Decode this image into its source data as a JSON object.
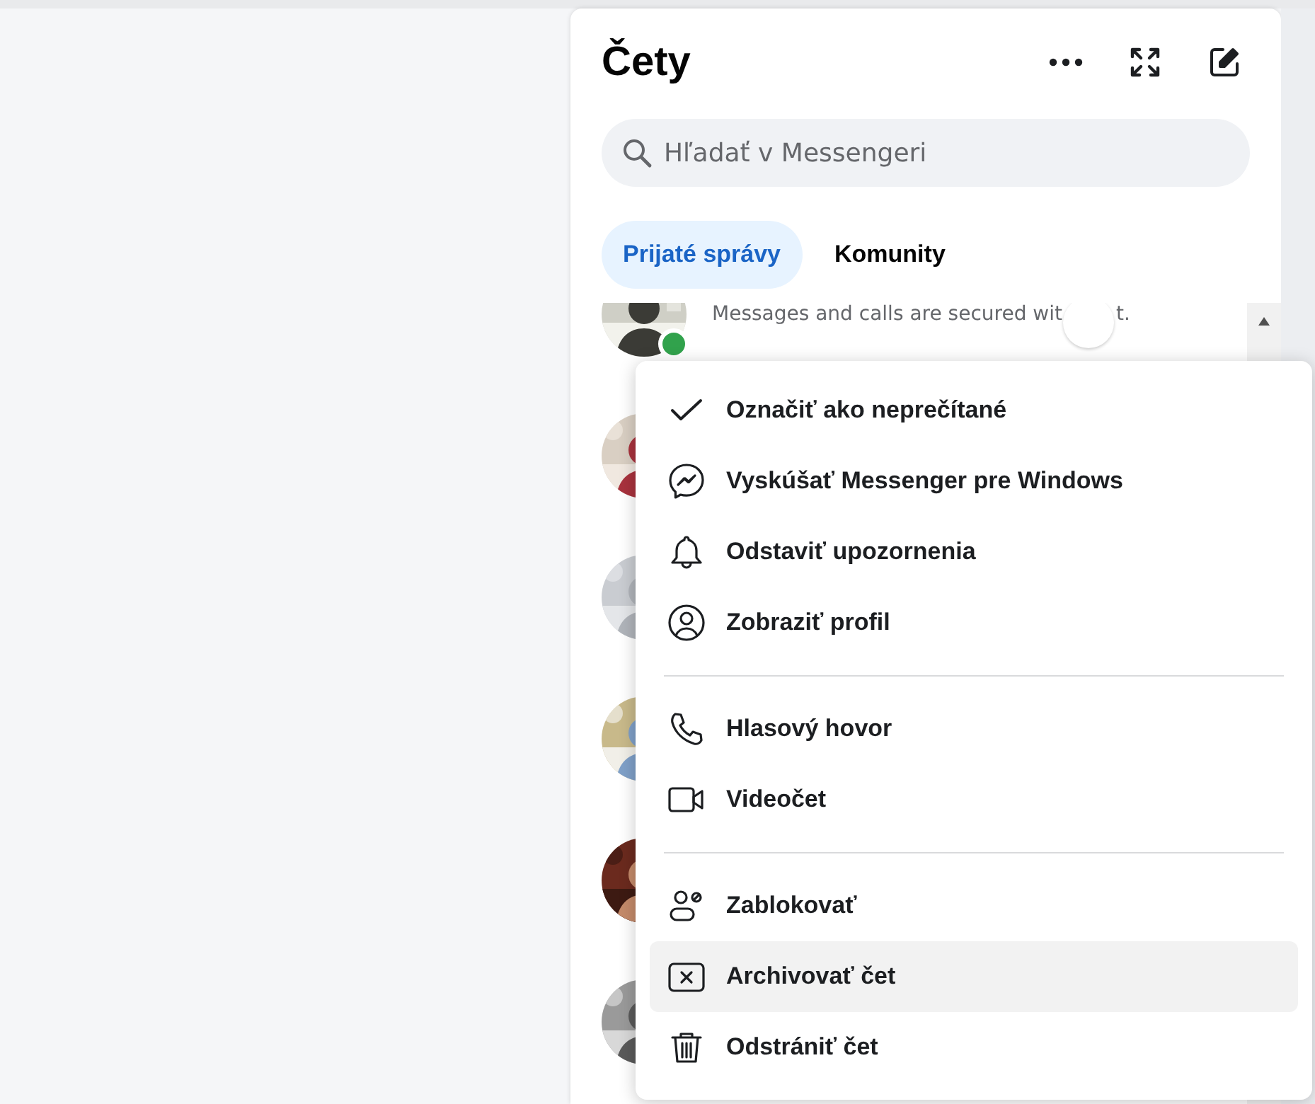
{
  "panel": {
    "title": "Čety",
    "search": {
      "placeholder": "Hľadať v Messengeri"
    },
    "tabs": [
      {
        "label": "Prijaté správy",
        "selected": true
      },
      {
        "label": "Komunity",
        "selected": false
      }
    ]
  },
  "chats": [
    {
      "avatar": {
        "kind": "picture"
      },
      "online": true,
      "preview": "Messages and calls are secured wit",
      "preview_end": "t."
    },
    {
      "avatar": {
        "kind": "picture"
      }
    },
    {
      "avatar": {
        "kind": "picture"
      }
    },
    {
      "avatar": {
        "kind": "picture"
      }
    },
    {
      "avatar": {
        "kind": "picture"
      }
    },
    {
      "avatar": {
        "kind": "picture"
      }
    }
  ],
  "menu": {
    "groups": [
      [
        {
          "kind": "check",
          "label": "Označiť ako neprečítané",
          "selected": false
        },
        {
          "kind": "messenger",
          "label": "Vyskúšať Messenger pre Windows",
          "selected": false
        },
        {
          "kind": "bell",
          "label": "Odstaviť upozornenia",
          "selected": false
        },
        {
          "kind": "profile",
          "label": "Zobraziť profil",
          "selected": false
        }
      ],
      [
        {
          "kind": "phone",
          "label": "Hlasový hovor",
          "selected": false
        },
        {
          "kind": "video",
          "label": "Videočet",
          "selected": false
        }
      ],
      [
        {
          "kind": "block",
          "label": "Zablokovať",
          "selected": false
        },
        {
          "kind": "archive",
          "label": "Archivovať čet",
          "selected": true
        },
        {
          "kind": "trash",
          "label": "Odstrániť čet",
          "selected": false
        }
      ]
    ]
  }
}
